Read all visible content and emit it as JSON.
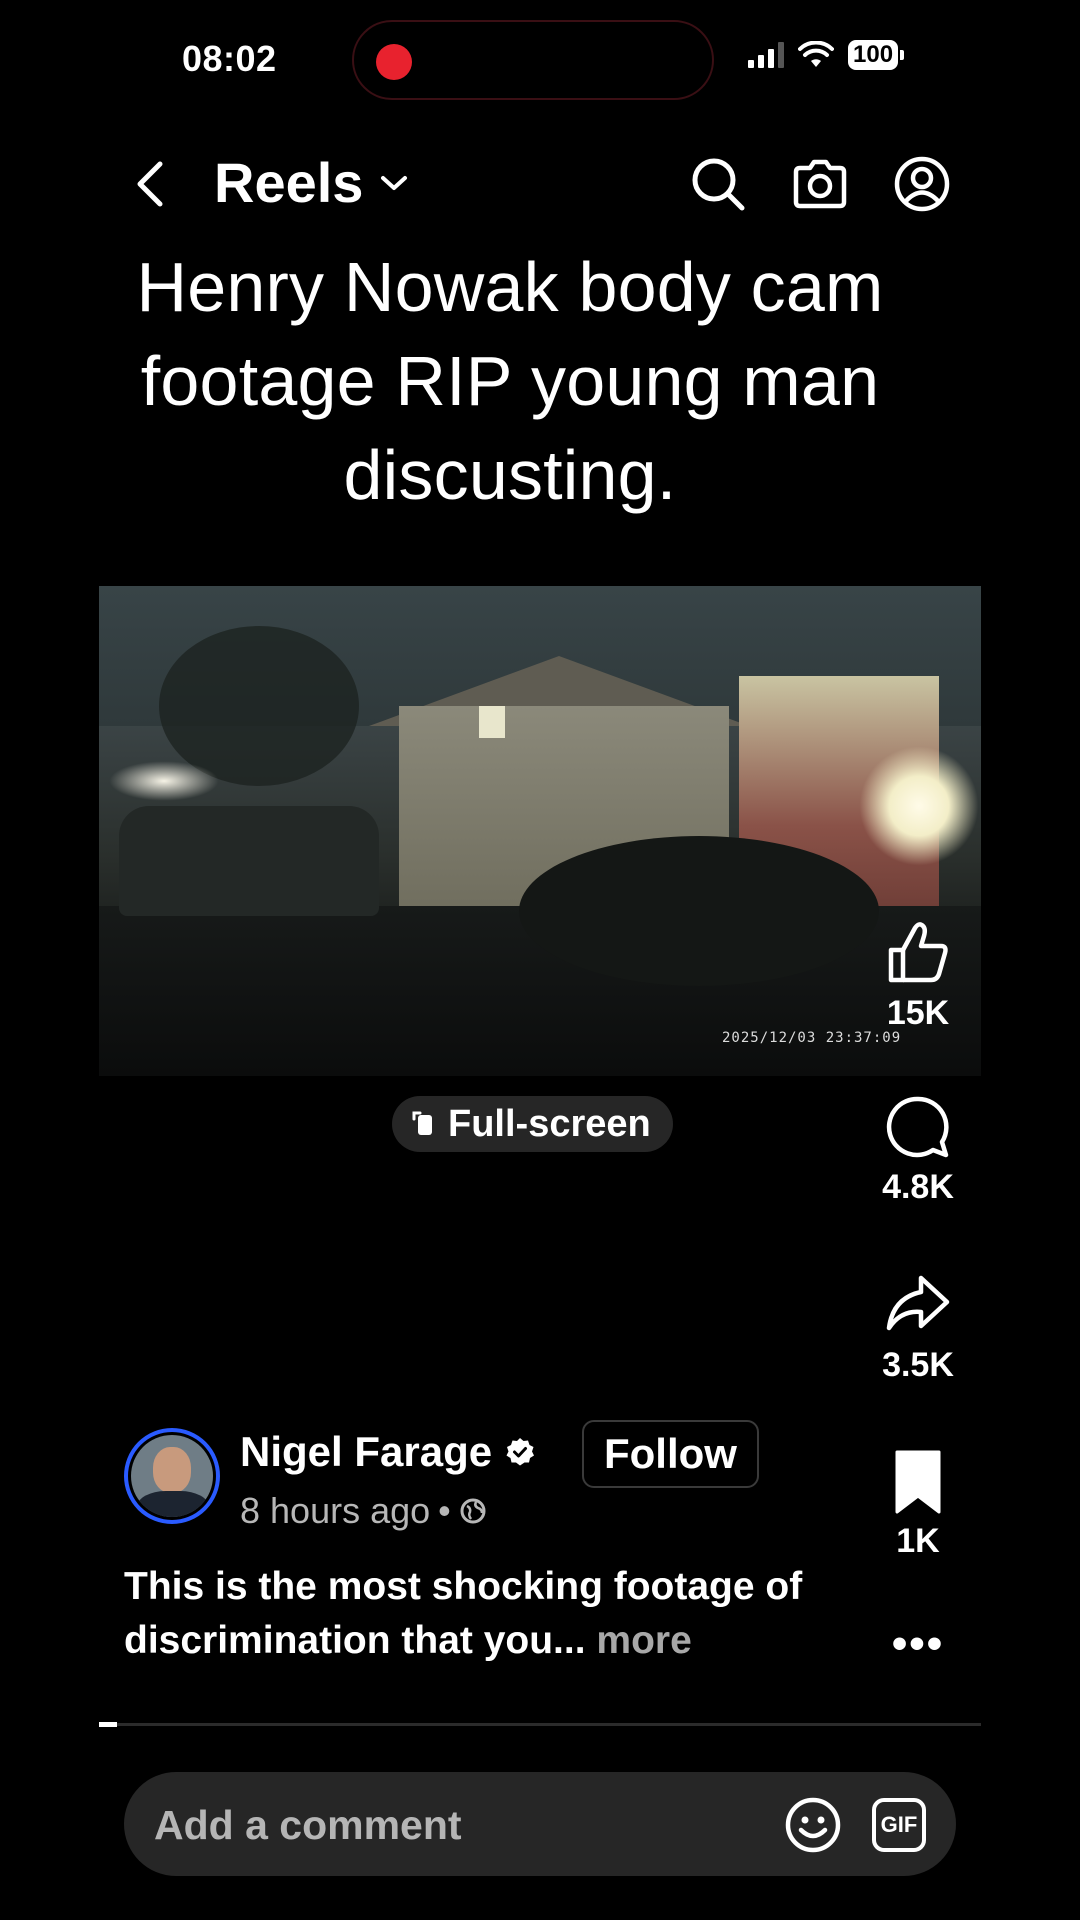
{
  "status_bar": {
    "time": "08:02",
    "battery": "100",
    "recording_color": "#e8222e"
  },
  "header": {
    "title": "Reels",
    "icons": [
      "back-chevron-icon",
      "dropdown-chevron-icon",
      "search-icon",
      "camera-icon",
      "profile-icon"
    ]
  },
  "video": {
    "title": "Henry Nowak body cam footage RIP young man discusting.",
    "timestamp": "2025/12/03   23:37:09",
    "fullscreen_label": "Full-screen",
    "progress": 0.02
  },
  "actions": {
    "like_count": "15K",
    "comment_count": "4.8K",
    "share_count": "3.5K",
    "save_count": "1K",
    "more_label": "•••"
  },
  "author": {
    "name": "Nigel Farage",
    "verified": true,
    "follow_label": "Follow",
    "time_ago": "8 hours ago",
    "meta_separator": "•",
    "avatar_ring_color": "#2a5bff"
  },
  "caption": {
    "text": "This is the most shocking footage of discrimination that you...",
    "more_label": "more"
  },
  "comment": {
    "placeholder": "Add a comment",
    "gif_label": "GIF"
  }
}
